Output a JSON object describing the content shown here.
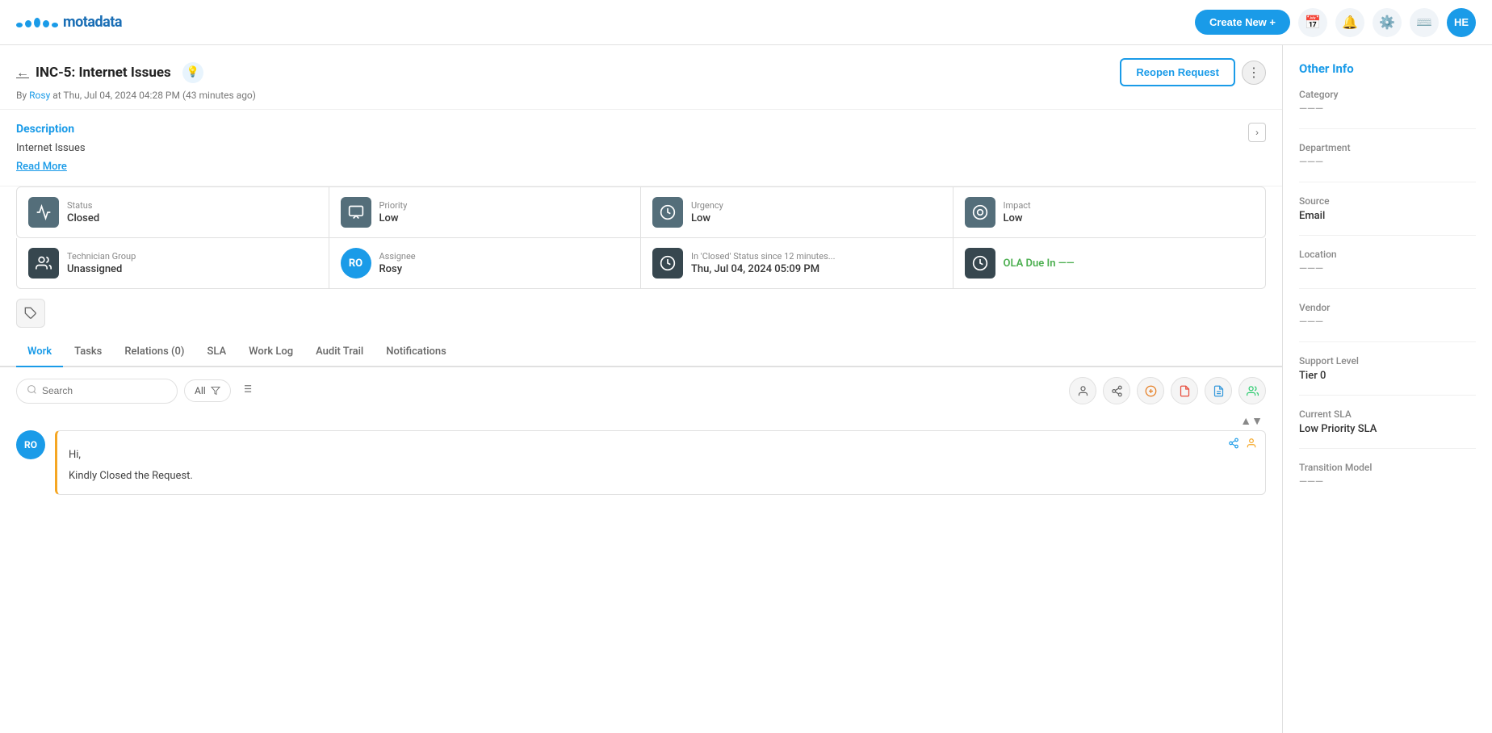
{
  "app": {
    "logo_text": "motadata",
    "create_btn": "Create New +",
    "nav_avatar": "HE"
  },
  "ticket": {
    "id": "INC-5: Internet Issues",
    "back_label": "←",
    "meta_by": "By",
    "meta_author": "Rosy",
    "meta_at": "at Thu, Jul 04, 2024 04:28 PM (43 minutes ago)",
    "reopen_btn": "Reopen Request",
    "description_title": "Description",
    "description_text": "Internet Issues",
    "read_more": "Read More"
  },
  "info_cards_row1": [
    {
      "label": "Status",
      "value": "Closed",
      "icon": "📊"
    },
    {
      "label": "Priority",
      "value": "Low",
      "icon": "🔄"
    },
    {
      "label": "Urgency",
      "value": "Low",
      "icon": "⏱"
    },
    {
      "label": "Impact",
      "value": "Low",
      "icon": "🎯"
    }
  ],
  "info_cards_row2": [
    {
      "label": "Technician Group",
      "value": "Unassigned",
      "icon": "person",
      "type": "icon"
    },
    {
      "label": "Assignee",
      "value": "Rosy",
      "avatar": "RO",
      "type": "avatar"
    },
    {
      "label": "In 'Closed' Status since  12 minutes...",
      "value": "Thu, Jul 04, 2024 05:09 PM",
      "icon": "⏱",
      "type": "clock"
    },
    {
      "label": "OLA Due In",
      "value": "OLA Due In ——",
      "icon": "⏱",
      "type": "ola"
    }
  ],
  "tabs": [
    {
      "label": "Work",
      "active": true
    },
    {
      "label": "Tasks",
      "active": false
    },
    {
      "label": "Relations (0)",
      "active": false
    },
    {
      "label": "SLA",
      "active": false
    },
    {
      "label": "Work Log",
      "active": false
    },
    {
      "label": "Audit Trail",
      "active": false
    },
    {
      "label": "Notifications",
      "active": false
    }
  ],
  "work": {
    "search_placeholder": "Search",
    "filter_label": "All"
  },
  "comment": {
    "avatar": "RO",
    "greeting": "Hi,",
    "body": "Kindly Closed the Request."
  },
  "right_panel": {
    "title": "Other Info",
    "fields": [
      {
        "label": "Category",
        "value": "———"
      },
      {
        "label": "Department",
        "value": "———"
      },
      {
        "label": "Source",
        "value": "Email"
      },
      {
        "label": "Location",
        "value": "———"
      },
      {
        "label": "Vendor",
        "value": "———"
      },
      {
        "label": "Support Level",
        "value": "Tier 0"
      },
      {
        "label": "Current SLA",
        "value": "Low Priority SLA"
      },
      {
        "label": "Transition Model",
        "value": "———"
      }
    ]
  }
}
